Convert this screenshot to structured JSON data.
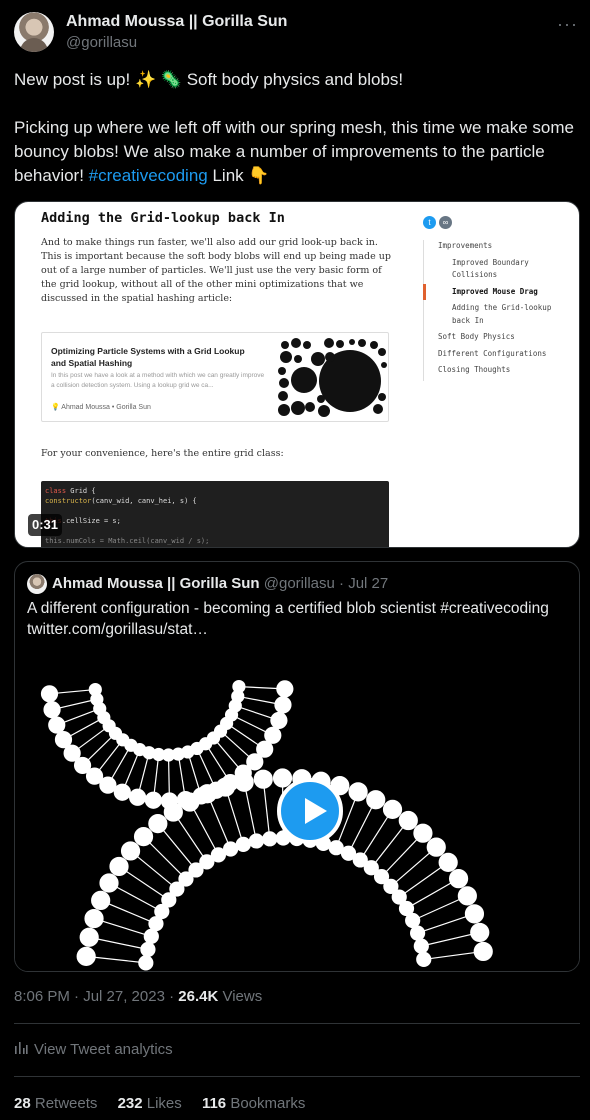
{
  "author": {
    "name": "Ahmad Moussa || Gorilla Sun",
    "handle": "@gorillasu"
  },
  "more_label": "···",
  "tweet": {
    "line1": "New post is up! ✨ 🦠 Soft body physics and blobs!",
    "line2_before": "Picking up where we left off with our spring mesh, this time we make some bouncy blobs! We also make a number of improvements to the particle behavior! ",
    "hashtag": "#creativecoding",
    "line2_after": " Link 👇"
  },
  "media": {
    "duration": "0:31",
    "article_title": "Adding the Grid-lookup back In",
    "article_paragraph": "And to make things run faster, we'll also add our grid look-up back in. This is important because the soft body blobs will end up being made up out of a large number of particles. We'll just use the very basic form of the grid lookup, without all of the other mini optimizations that we discussed in the spatial hashing article:",
    "card_title": "Optimizing Particle Systems with a Grid Lookup and Spatial Hashing",
    "card_desc": "In this post we have a look at a method with which we can greatly improve a collision detection system. Using a lookup grid we ca...",
    "card_author": "💡 Ahmad Moussa  •  Gorilla Sun",
    "convenience": "For your convenience, here's the entire grid class:",
    "code_line1_kw": "class",
    "code_line1_rest": " Grid {",
    "code_line2_fn": "  constructor",
    "code_line2_rest": "(canv_wid, canv_hei, s) {",
    "code_line3_kw": "    this",
    "code_line3_rest": ".cellSize = s;",
    "code_line4": "    this.numCols = Math.ceil(canv_wid / s);",
    "toc": {
      "improvements": "Improvements",
      "boundary": "Improved Boundary Collisions",
      "mouse": "Improved Mouse Drag",
      "grid": "Adding the Grid-lookup back In",
      "soft": "Soft Body Physics",
      "configs": "Different Configurations",
      "closing": "Closing Thoughts"
    }
  },
  "quote": {
    "name": "Ahmad Moussa || Gorilla Sun",
    "handle": "@gorillasu",
    "sep": " · ",
    "date": "Jul 27",
    "text_before": "A different configuration - becoming a certified blob scientist ",
    "hashtag": "#creativecoding",
    "link": "twitter.com/gorillasu/stat…"
  },
  "footer": {
    "time": "8:06 PM · Jul 27, 2023 · ",
    "views_count": "26.4K",
    "views_label": " Views",
    "analytics": "View Tweet analytics",
    "retweets_count": "28",
    "retweets_label": " Retweets",
    "likes_count": "232",
    "likes_label": " Likes",
    "bookmarks_count": "116",
    "bookmarks_label": " Bookmarks"
  }
}
